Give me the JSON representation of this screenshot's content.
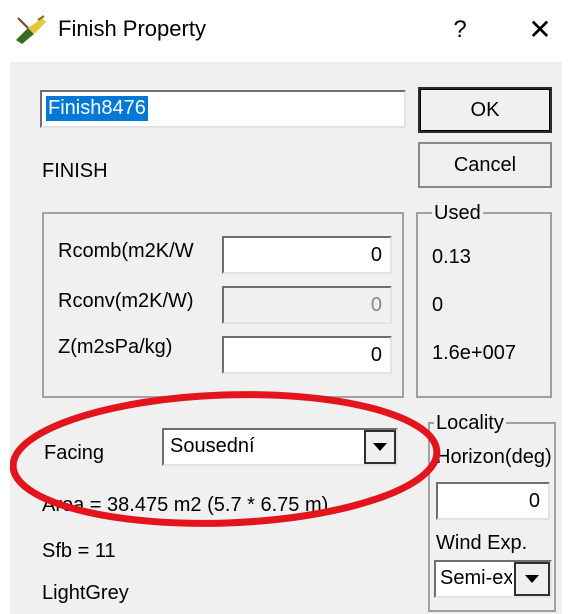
{
  "window": {
    "title": "Finish Property",
    "help_label": "?",
    "close_label": "✕"
  },
  "name_field": {
    "value": "Finish8476"
  },
  "buttons": {
    "ok": "OK",
    "cancel": "Cancel"
  },
  "type_label": "FINISH",
  "properties": {
    "rcomb_label": "Rcomb(m2K/W",
    "rcomb_value": "0",
    "rconv_label": "Rconv(m2K/W)",
    "rconv_value": "0",
    "z_label": "Z(m2sPa/kg)",
    "z_value": "0"
  },
  "used": {
    "legend": "Used",
    "values": [
      "0.13",
      "0",
      "1.6e+007"
    ]
  },
  "facing": {
    "label": "Facing",
    "selected": "Sousední"
  },
  "info": {
    "area": "Area = 38.475 m2 (5.7 * 6.75 m)",
    "sfb": "Sfb = 11",
    "color": "LightGrey"
  },
  "locality": {
    "legend": "Locality",
    "horizon_label": "Horizon(deg)",
    "horizon_value": "0",
    "wind_label": "Wind Exp.",
    "wind_selected": "Semi-exposed"
  },
  "annotation_color": "#e3141b"
}
